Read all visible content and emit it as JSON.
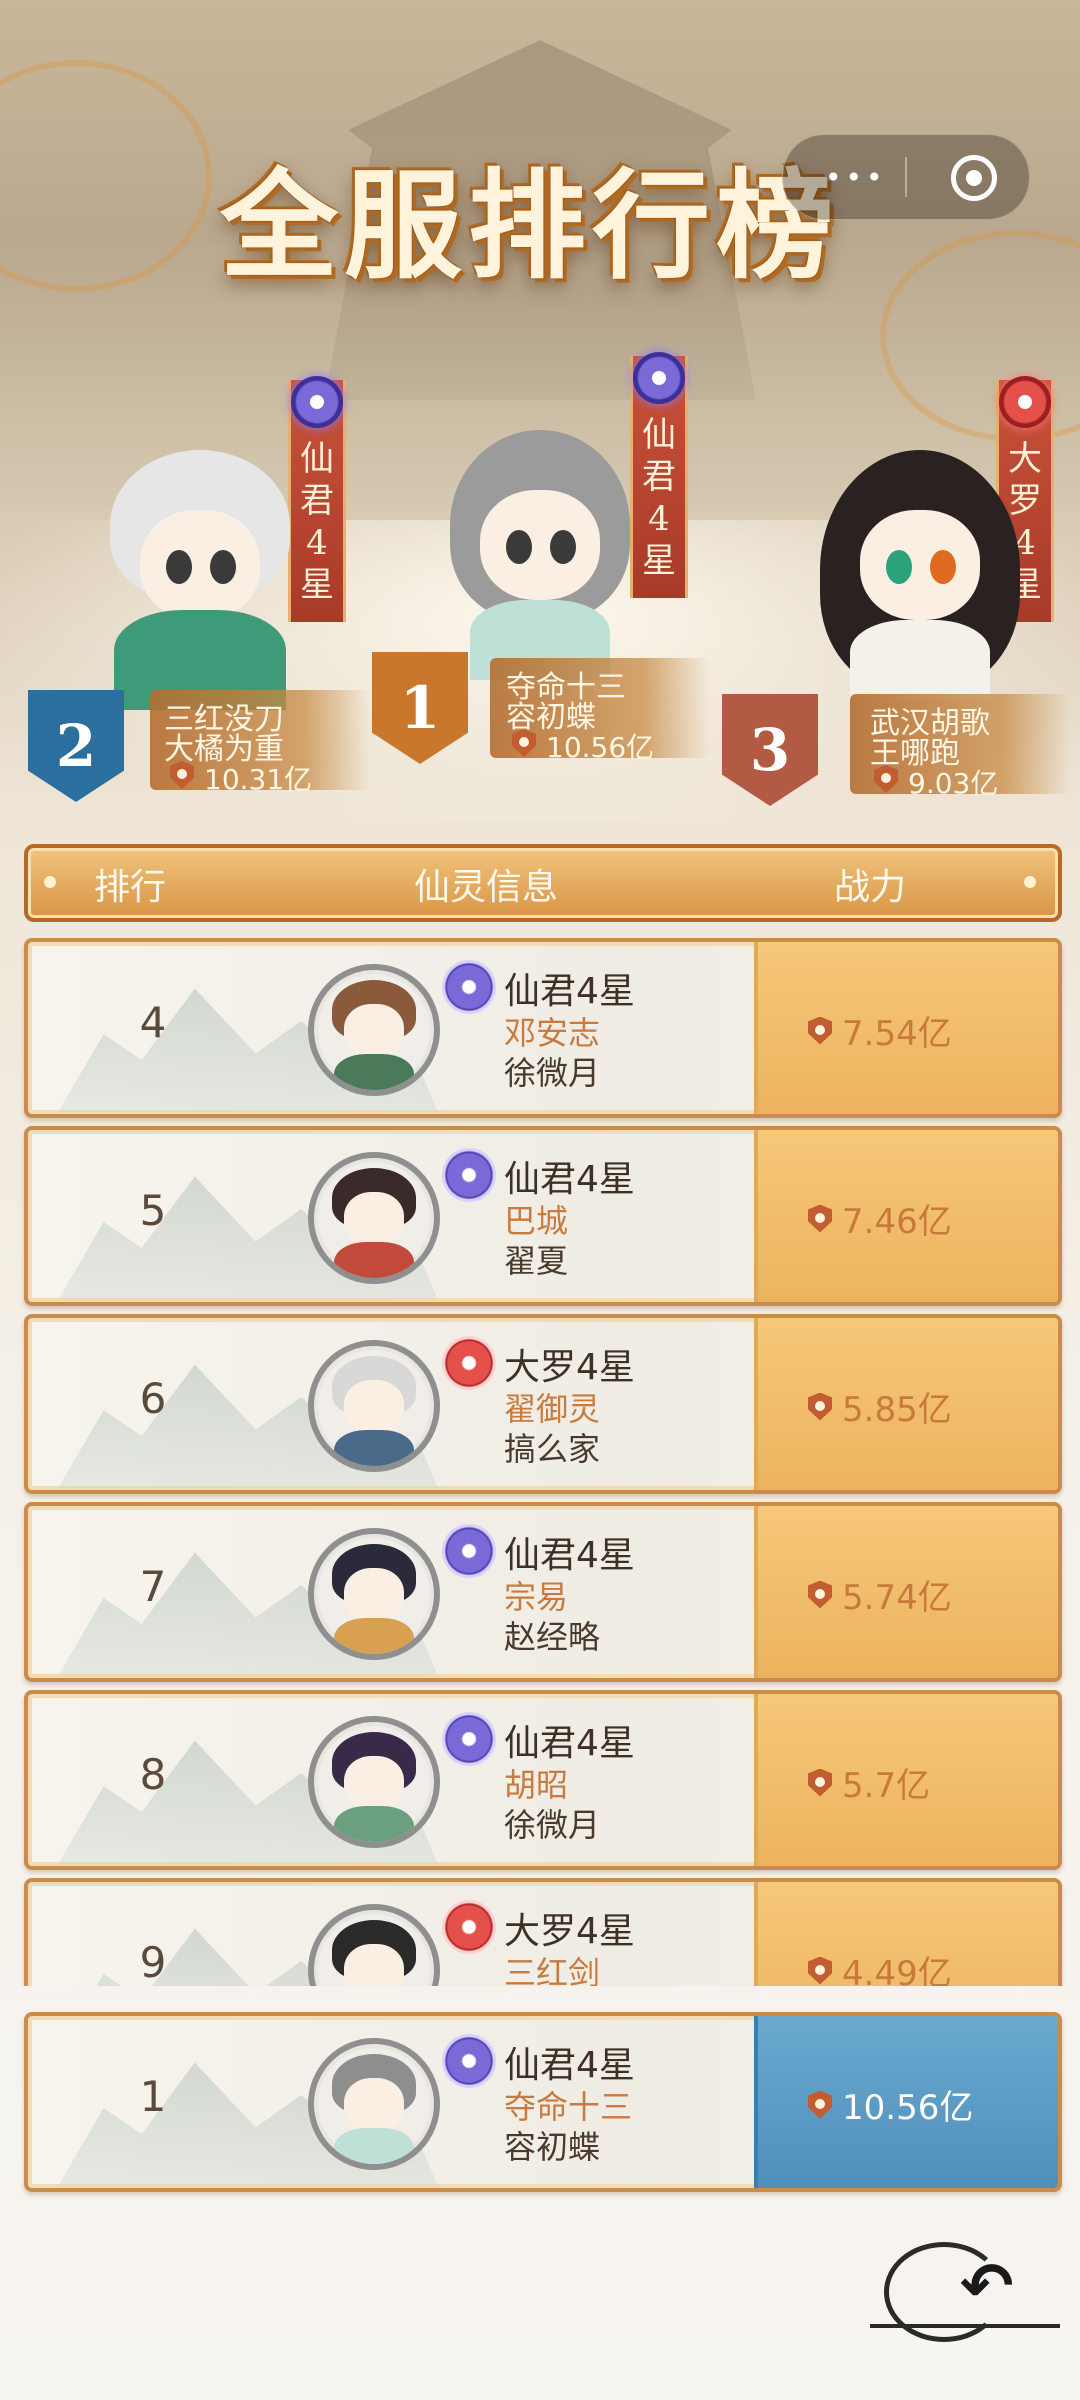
{
  "header": {
    "title": "全服排行榜",
    "capsule": {
      "more_icon": "more-dots-icon",
      "close_icon": "target-close-icon"
    }
  },
  "podium": [
    {
      "rank": "2",
      "realm": "仙君4星",
      "realm_icon": "purple-gem-icon",
      "name": "三红没刀",
      "user": "大橘为重",
      "power": "10.31亿"
    },
    {
      "rank": "1",
      "realm": "仙君4星",
      "realm_icon": "purple-gem-icon",
      "name": "夺命十三",
      "user": "容初蝶",
      "power": "10.56亿"
    },
    {
      "rank": "3",
      "realm": "大罗4星",
      "realm_icon": "red-gem-icon",
      "name": "武汉胡歌",
      "user": "王哪跑",
      "power": "9.03亿"
    }
  ],
  "table": {
    "headers": {
      "rank": "排行",
      "info": "仙灵信息",
      "power": "战力"
    },
    "rows": [
      {
        "rank": "4",
        "realm": "仙君4星",
        "gem": "purple",
        "name": "邓安志",
        "user": "徐微月",
        "power": "7.54亿"
      },
      {
        "rank": "5",
        "realm": "仙君4星",
        "gem": "purple",
        "name": "巴城",
        "user": "翟夏",
        "power": "7.46亿"
      },
      {
        "rank": "6",
        "realm": "大罗4星",
        "gem": "red",
        "name": "翟御灵",
        "user": "搞么家",
        "power": "5.85亿"
      },
      {
        "rank": "7",
        "realm": "仙君4星",
        "gem": "purple",
        "name": "宗易",
        "user": "赵经略",
        "power": "5.74亿"
      },
      {
        "rank": "8",
        "realm": "仙君4星",
        "gem": "purple",
        "name": "胡昭",
        "user": "徐微月",
        "power": "5.7亿"
      },
      {
        "rank": "9",
        "realm": "大罗4星",
        "gem": "red",
        "name": "三红剑",
        "user": "",
        "power": "4.49亿"
      }
    ]
  },
  "my_rank": {
    "rank": "1",
    "realm": "仙君4星",
    "gem": "purple",
    "name": "夺命十三",
    "user": "容初蝶",
    "power": "10.56亿"
  },
  "colors": {
    "accent": "#d99546",
    "my_power_bg": "#4f8fbb",
    "name_color": "#c97a3e"
  }
}
